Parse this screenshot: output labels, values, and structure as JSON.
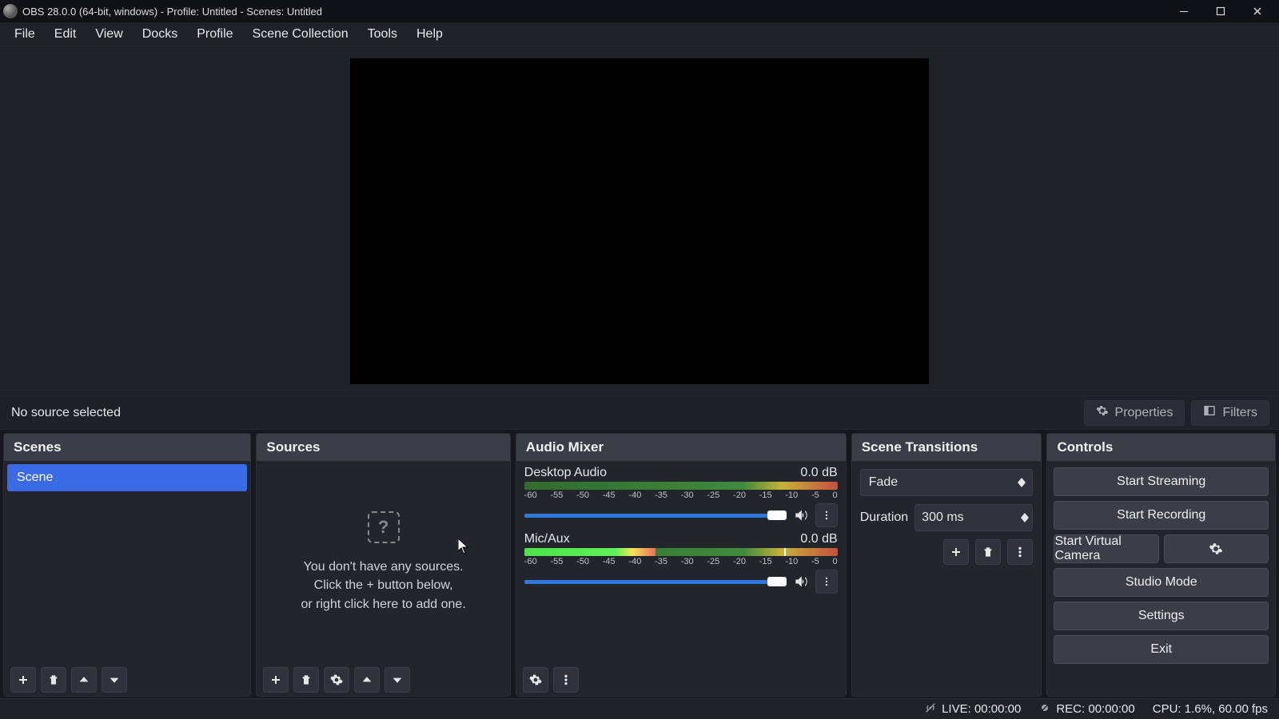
{
  "title": "OBS 28.0.0 (64-bit, windows) - Profile: Untitled - Scenes: Untitled",
  "menu": [
    "File",
    "Edit",
    "View",
    "Docks",
    "Profile",
    "Scene Collection",
    "Tools",
    "Help"
  ],
  "contextbar": {
    "status": "No source selected",
    "properties": "Properties",
    "filters": "Filters"
  },
  "scenes": {
    "header": "Scenes",
    "items": [
      "Scene"
    ]
  },
  "sources": {
    "header": "Sources",
    "empty1": "You don't have any sources.",
    "empty2": "Click the + button below,",
    "empty3": "or right click here to add one."
  },
  "mixer": {
    "header": "Audio Mixer",
    "ticks": [
      "-60",
      "-55",
      "-50",
      "-45",
      "-40",
      "-35",
      "-30",
      "-25",
      "-20",
      "-15",
      "-10",
      "-5",
      "0"
    ],
    "ch": [
      {
        "name": "Desktop Audio",
        "db": "0.0 dB"
      },
      {
        "name": "Mic/Aux",
        "db": "0.0 dB"
      }
    ]
  },
  "transitions": {
    "header": "Scene Transitions",
    "type": "Fade",
    "duration_label": "Duration",
    "duration": "300 ms"
  },
  "controls": {
    "header": "Controls",
    "buttons": {
      "stream": "Start Streaming",
      "record": "Start Recording",
      "vcam": "Start Virtual Camera",
      "studio": "Studio Mode",
      "settings": "Settings",
      "exit": "Exit"
    }
  },
  "statusbar": {
    "live": "LIVE: 00:00:00",
    "rec": "REC: 00:00:00",
    "cpu": "CPU: 1.6%, 60.00 fps"
  }
}
